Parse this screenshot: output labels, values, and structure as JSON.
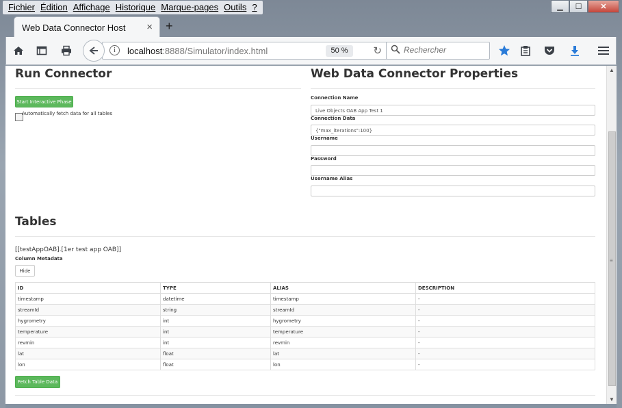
{
  "menu": [
    "Fichier",
    "Édition",
    "Affichage",
    "Historique",
    "Marque-pages",
    "Outils",
    "?"
  ],
  "window_buttons": {
    "minimize": "▁",
    "maximize": "☐",
    "close": "✕"
  },
  "tab": {
    "title": "Web Data Connector Host",
    "close": "×",
    "new_tab": "+"
  },
  "toolbar": {
    "url_host": "localhost",
    "url_rest": ":8888/Simulator/index.html",
    "zoom": "50 %",
    "search_placeholder": "Rechercher",
    "icons": [
      "home-icon",
      "reader-view-icon",
      "print-icon",
      "back-icon",
      "info-icon",
      "reload-icon",
      "search-icon",
      "bookmark-star-icon",
      "clipboard-icon",
      "pocket-icon",
      "download-icon",
      "menu-icon"
    ]
  },
  "run_connector": {
    "title": "Run Connector",
    "start_button": "Start Interactive Phase",
    "auto_fetch_label": "Automatically fetch data for all tables"
  },
  "properties": {
    "title": "Web Data Connector Properties",
    "connection_name_label": "Connection Name",
    "connection_name_value": "Live Objects OAB App Test 1",
    "connection_data_label": "Connection Data",
    "connection_data_value": "{\"max_iterations\":100}",
    "username_label": "Username",
    "username_value": "",
    "password_label": "Password",
    "password_value": "",
    "username_alias_label": "Username Alias",
    "username_alias_value": ""
  },
  "tables": {
    "title": "Tables",
    "table_name": "[[testAppOAB].[1er test app OAB]]",
    "column_metadata_label": "Column Metadata",
    "hide_button": "Hide",
    "headers": [
      "ID",
      "TYPE",
      "ALIAS",
      "DESCRIPTION"
    ],
    "rows": [
      [
        "timestamp",
        "datetime",
        "timestamp",
        "-"
      ],
      [
        "streamId",
        "string",
        "streamId",
        "-"
      ],
      [
        "hygrometry",
        "int",
        "hygrometry",
        "-"
      ],
      [
        "temperature",
        "int",
        "temperature",
        "-"
      ],
      [
        "revmin",
        "int",
        "revmin",
        "-"
      ],
      [
        "lat",
        "float",
        "lat",
        "-"
      ],
      [
        "lon",
        "float",
        "lon",
        "-"
      ]
    ],
    "fetch_button": "Fetch Table Data"
  }
}
